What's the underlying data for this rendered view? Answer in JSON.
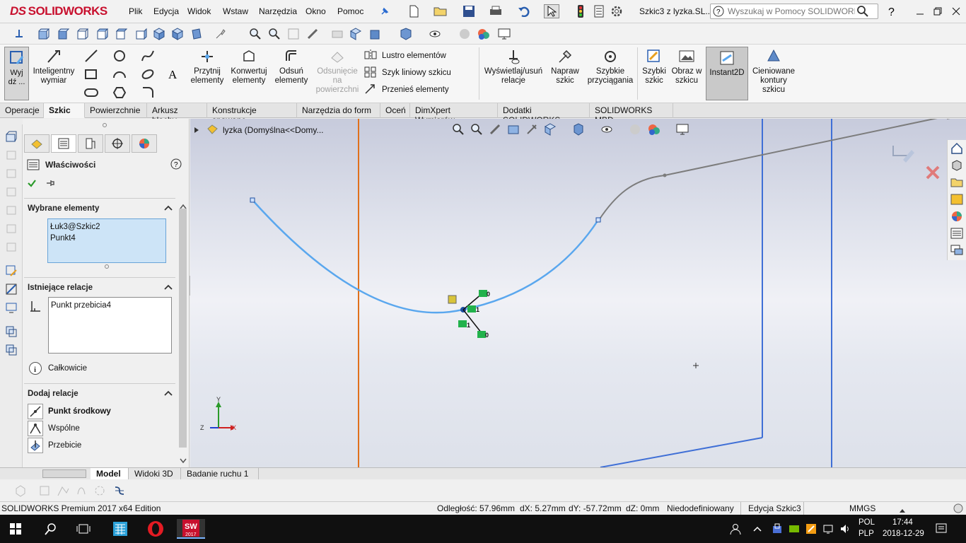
{
  "app": {
    "logo_text": "SOLIDWORKS",
    "logo_ds": "DS",
    "window_title": "Szkic3 z lyzka.SL...",
    "search_placeholder": "Wyszukaj w Pomocy SOLIDWORKS"
  },
  "menu": [
    "Plik",
    "Edycja",
    "Widok",
    "Wstaw",
    "Narzędzia",
    "Okno",
    "Pomoc"
  ],
  "ribbon": {
    "exit_sketch": "Wyj dź ...",
    "smart_dimension": "Inteligentny wymiar",
    "trim": "Przytnij elementy",
    "convert": "Konwertuj elementy",
    "offset": "Odsuń elementy",
    "offset_surface": "Odsunięcie na powierzchni",
    "mirror": "Lustro elementów",
    "linear_pattern": "Szyk liniowy szkicu",
    "move": "Przenieś elementy",
    "display_relations": "Wyświetlaj/usuń relacje",
    "repair": "Napraw szkic",
    "quick_snaps": "Szybkie przyciągania",
    "rapid_sketch": "Szybki szkic",
    "sketch_picture": "Obraz w szkicu",
    "instant2d": "Instant2D",
    "shaded_contours": "Cieniowane kontury szkicu"
  },
  "command_tabs": [
    "Operacje",
    "Szkic",
    "Powierzchnie",
    "Arkusz blachy",
    "Konstrukcje spawane",
    "Narzędzia do form",
    "Oceń",
    "DimXpert Wymiarów",
    "Dodatki SOLIDWORKS",
    "SOLIDWORKS MBD"
  ],
  "property_manager": {
    "title": "Właściwości",
    "selected_title": "Wybrane elementy",
    "selected_items": [
      "Łuk3@Szkic2",
      "Punkt4"
    ],
    "existing_title": "Istniejące relacje",
    "existing_items": [
      "Punkt przebicia4"
    ],
    "status": "Całkowicie",
    "add_title": "Dodaj relacje",
    "add_items": [
      "Punkt środkowy",
      "Wspólne",
      "Przebicie"
    ]
  },
  "tree": {
    "part_name": "lyzka  (Domyślna<<Domy..."
  },
  "triad": {
    "x": "X",
    "y": "Y",
    "z": "Z"
  },
  "relation_labels": [
    "0",
    "1",
    "1",
    "0"
  ],
  "bottom_tabs": [
    "Model",
    "Widoki 3D",
    "Badanie ruchu 1"
  ],
  "status": {
    "edition": "SOLIDWORKS Premium 2017 x64 Edition",
    "distance": "Odległość: 57.96mm",
    "dx": "dX: 5.27mm",
    "dy": "dY: -57.72mm",
    "dz": "dZ: 0mm",
    "definition": "Niedodefiniowany",
    "mode": "Edycja Szkic3",
    "units": "MMGS"
  },
  "taskbar": {
    "lang1": "POL",
    "lang2": "PLP",
    "time": "17:44",
    "date": "2018-12-29",
    "sw_label": "2017"
  },
  "colors": {
    "accent_red": "#c8102e",
    "sketch_blue": "#5aa7ee",
    "plane_orange": "#e0701c",
    "edge_blue": "#3f6fd6"
  }
}
